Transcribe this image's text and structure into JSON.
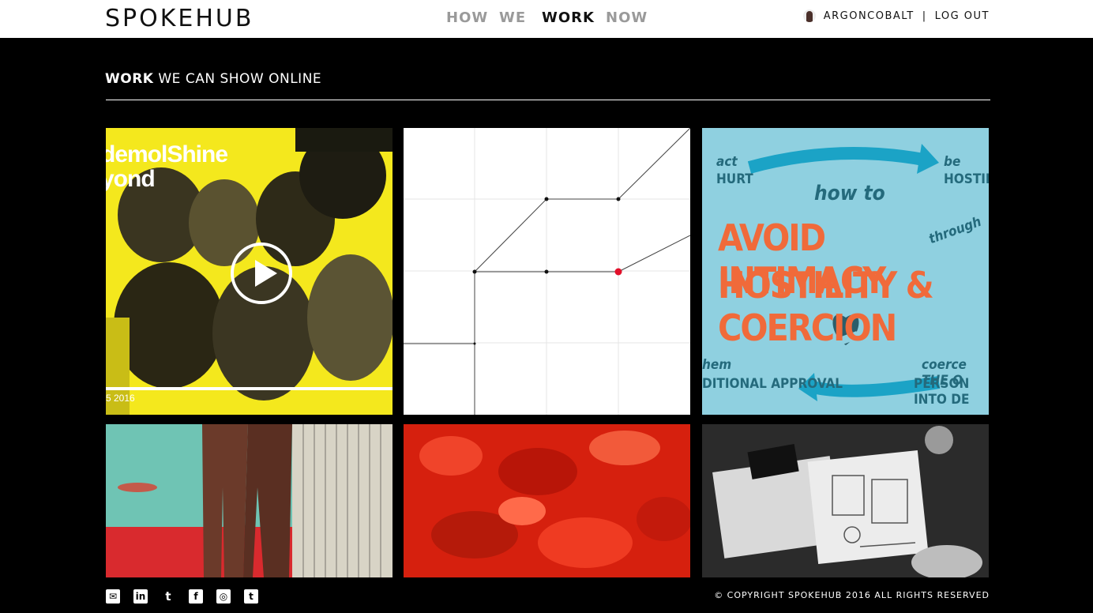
{
  "header": {
    "logo": "SPOKEHUB",
    "nav": [
      "HOW",
      "WE",
      "WORK",
      "NOW"
    ],
    "active_nav": "WORK",
    "username": "ARGONCOBALT",
    "separator": "|",
    "logout": "LOG OUT"
  },
  "section": {
    "title_bold": "WORK",
    "title_rest": " WE CAN SHOW ONLINE"
  },
  "tiles": [
    {
      "kind": "video",
      "text_line1": "demolShine",
      "text_line2": "yond",
      "year": "5 2016",
      "icon": "play-icon"
    },
    {
      "kind": "diagram"
    },
    {
      "kind": "illustration",
      "big1": "AVOID INTIMACY",
      "big2": "HOSTILITY & COERCION",
      "how_to": "how to",
      "through": "through",
      "act": "act",
      "hurt": "HURT",
      "be": "be",
      "hostile": "HOSTILE",
      "hem": "hem",
      "approval": "DITIONAL APPROVAL",
      "coerce": "coerce THE O",
      "person": "PERSON INTO DE"
    },
    {
      "kind": "photo"
    },
    {
      "kind": "photo"
    },
    {
      "kind": "photo"
    }
  ],
  "footer": {
    "social": [
      "mail-icon",
      "linkedin-icon",
      "twitter-icon",
      "facebook-icon",
      "instagram-icon",
      "tumblr-icon"
    ],
    "social_glyphs": [
      "✉",
      "in",
      "t",
      "f",
      "◎",
      "t"
    ],
    "copyright": "© COPYRIGHT SPOKEHUB 2016 ALL RIGHTS RESERVED"
  },
  "colors": {
    "background": "#000000",
    "topbar": "#ffffff",
    "nav_inactive": "#9a9a9a",
    "nav_active": "#111111",
    "tile1_bg": "#f4e81d",
    "tile3_bg": "#8fd0e0",
    "accent_red": "#e2102a",
    "orange_text": "#f06a3a"
  }
}
